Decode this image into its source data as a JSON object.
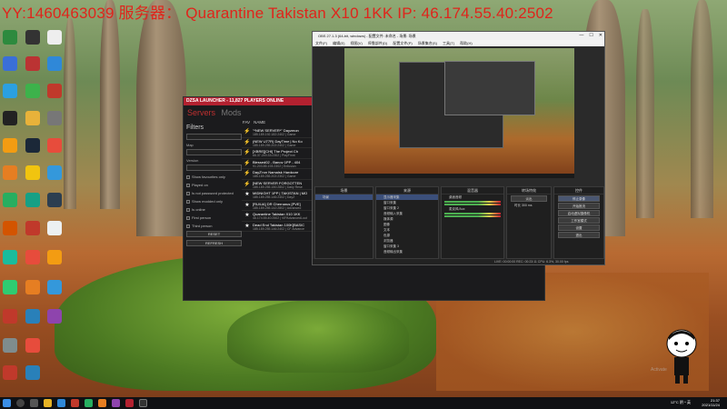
{
  "overlay_text": "YY:1460463039  服务器：  Quarantine Takistan X10 1KK   IP: 46.174.55.40:2502",
  "launcher": {
    "title": "DZSA LAUNCHER - 11,827 PLAYERS ONLINE",
    "tabs": [
      "Servers",
      "Mods"
    ],
    "filters_heading": "Filters",
    "map_label": "Map",
    "version_label": "Version",
    "checkboxes": [
      "Show favourites only",
      "Played on",
      "Is not password protected",
      "Show modded only",
      "Is online",
      "First person",
      "Third person"
    ],
    "reset_label": "RESET",
    "refresh_label": "REFRESH",
    "columns": [
      "FAV",
      "NAME"
    ],
    "servers": [
      {
        "name": "\"*NEW SERVER*\" Dayzmon",
        "detail": "185.189.192.182:2402 | Game",
        "fav": false,
        "icon": "bolt-icon"
      },
      {
        "name": "(NEW U77R) DayTime | No Ko",
        "detail": "185.189.255.202:2402 | Game",
        "fav": false,
        "icon": "bolt-icon"
      },
      {
        "name": "[XBRE][CHI] The Project Ch",
        "detail": "66.37.249.33:2302 | PlayFinnt",
        "fav": false,
        "icon": "bolt-icon"
      },
      {
        "name": "Blessed02 - Banov 1PP - 404",
        "detail": "91.203.85.193:2302 | Enfusion",
        "fav": false,
        "icon": "bolt-icon"
      },
      {
        "name": "DayZ'ron Namalsk Hardcore",
        "detail": "185.189.255.202:2302 | Game",
        "fav": false,
        "icon": "bolt-icon"
      },
      {
        "name": "[NEW SERVER FORGOTTEN",
        "detail": "185.189.255.150:2802 | Daily Rese",
        "fav": false,
        "icon": "bolt-icon"
      },
      {
        "name": "MIDNIGHT 1PP | TAKISTAN | MO",
        "detail": "185.189.255.146:2402 | DayZ",
        "fav": true,
        "icon": "star-icon"
      },
      {
        "name": "[RU/UA] DR Chernarus [PVE]",
        "detail": "185.189.255.142:2802 | Advanced",
        "fav": true,
        "icon": "star-icon"
      },
      {
        "name": "Quarantine Takistan X10 1KK",
        "detail": "46.174.55.40:2502 | VIPAdvancedLoot",
        "fav": true,
        "icon": "star-icon"
      },
      {
        "name": "Dead End Takistan 100K[BASIC",
        "detail": "185.189.255.146:2402 | CF Advance",
        "fav": true,
        "icon": "star-icon"
      }
    ]
  },
  "obs": {
    "title": "OBS 27.1.3 (64-bit, windows) - 配置文件: 未命名 - 场景: 场景",
    "menu": [
      "文件(F)",
      "编辑(E)",
      "视图(V)",
      "停靠部件(D)",
      "配置文件(P)",
      "场景集合(S)",
      "工具(T)",
      "帮助(H)"
    ],
    "docks": {
      "scenes_header": "场景",
      "scene_items": [
        "场景"
      ],
      "sources_header": "来源",
      "source_items": [
        "显示器采集",
        "窗口采集",
        "窗口采集 2",
        "音频输入采集",
        "媒体源",
        "图像",
        "文本",
        "色源",
        "浏览器",
        "窗口采集 3",
        "音频输出采集"
      ],
      "mixer_header": "混音器",
      "mixer_items": [
        "桌面音频",
        "麦克风/Aux"
      ],
      "transitions_header": "转场特效",
      "transition_value": "淡出",
      "duration_label": "时长",
      "duration_value": "300 ms",
      "controls_header": "控件",
      "controls": [
        "停止录像",
        "开始推流",
        "启动虚拟摄像机",
        "工作室模式",
        "设置",
        "退出"
      ]
    },
    "status": "LIVE: 00:00:00   REC: 00:23:11   CPU: 6.3%, 30.00 fps"
  },
  "taskbar": {
    "clock_time": "21:37",
    "clock_date": "2021/11/24",
    "tray_text": "12°C 阴 ^ 英"
  },
  "watermark": "Activate"
}
